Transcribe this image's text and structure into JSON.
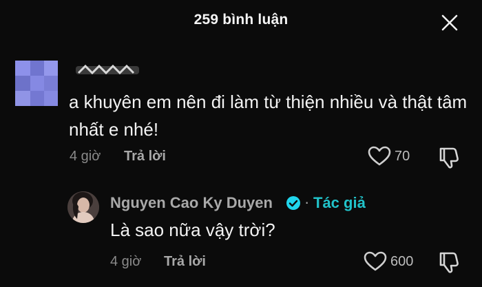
{
  "header": {
    "title": "259 bình luận",
    "close_icon": "close-icon"
  },
  "comment": {
    "avatar": "blurred-avatar",
    "username_hidden": true,
    "text": "a khuyên em nên đi làm từ thiện nhiều và thật tâm nhất e nhé!",
    "time": "4 giờ",
    "reply_label": "Trả lời",
    "like_icon": "heart-outline-icon",
    "like_count": "70",
    "dislike_icon": "thumbs-down-icon"
  },
  "reply": {
    "avatar": "user-avatar",
    "name": "Nguyen Cao Ky Duyen",
    "verified_icon": "verified-badge-icon",
    "separator": "·",
    "author_label": "Tác giả",
    "text": "Là sao nữa vậy trời?",
    "time": "4 giờ",
    "reply_label": "Trả lời",
    "like_icon": "heart-outline-icon",
    "like_count": "600",
    "dislike_icon": "thumbs-down-icon"
  },
  "colors": {
    "background": "#0b0b0b",
    "primary_text": "#f3f3f3",
    "secondary_text": "#8a8a8a",
    "author_accent": "#21c2c9",
    "verified": "#20d5ec"
  }
}
